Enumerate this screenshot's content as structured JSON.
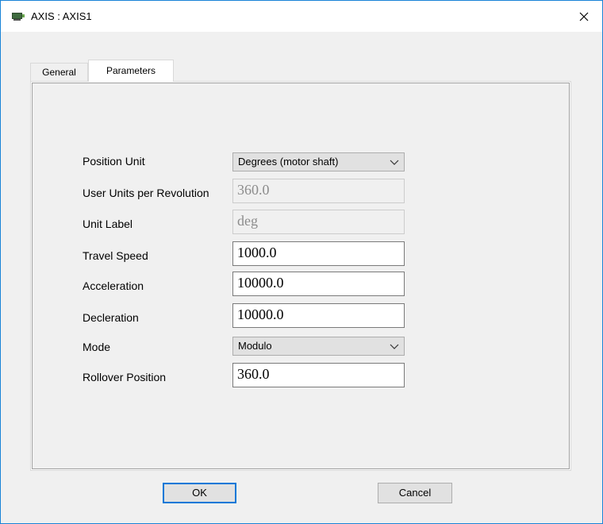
{
  "window": {
    "title": "AXIS : AXIS1",
    "close_glyph": "✕"
  },
  "tabs": [
    {
      "label": "General",
      "active": false
    },
    {
      "label": "Parameters",
      "active": true
    }
  ],
  "form": {
    "position_unit": {
      "label": "Position Unit",
      "value": "Degrees (motor shaft)"
    },
    "user_units": {
      "label": "User Units per Revolution",
      "value": "360.0",
      "disabled": true
    },
    "unit_label": {
      "label": "Unit Label",
      "value": "deg",
      "disabled": true
    },
    "travel_speed": {
      "label": "Travel Speed",
      "value": "1000.0"
    },
    "acceleration": {
      "label": "Acceleration",
      "value": "10000.0"
    },
    "deceleration": {
      "label": "Decleration",
      "value": "10000.0"
    },
    "mode": {
      "label": "Mode",
      "value": "Modulo"
    },
    "rollover": {
      "label": "Rollover Position",
      "value": "360.0"
    }
  },
  "buttons": {
    "ok": "OK",
    "cancel": "Cancel"
  },
  "icons": {
    "app": "axis-app-icon",
    "close": "close-icon",
    "dropdown": "chevron-down-icon"
  },
  "colors": {
    "accent": "#0078d7",
    "border": "#1883d7"
  }
}
